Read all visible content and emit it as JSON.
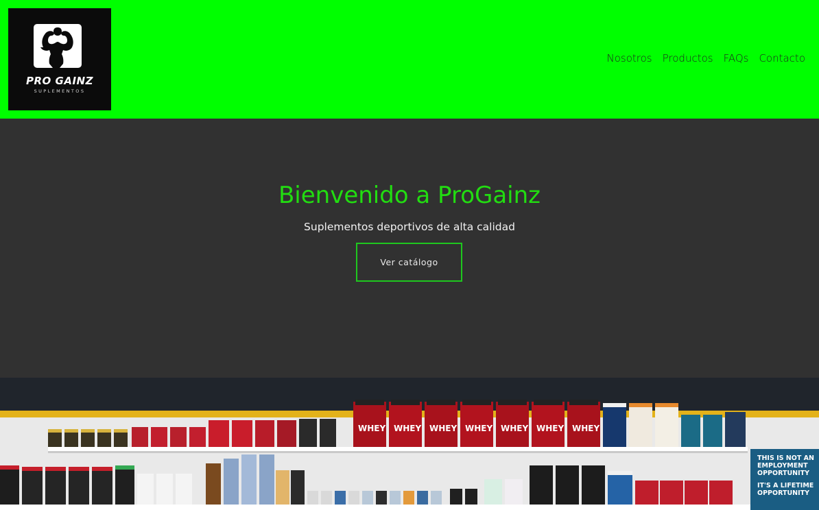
{
  "header": {
    "logo": {
      "brand": "PRO GAINZ",
      "tagline": "SUPLEMENTOS"
    },
    "nav": [
      "Nosotros",
      "Productos",
      "FAQs",
      "Contacto"
    ]
  },
  "hero": {
    "title": "Bienvenido a ProGainz",
    "subtitle": "Suplementos deportivos de alta calidad",
    "cta_label": "Ver catálogo"
  },
  "photo": {
    "poster_lines": [
      "THIS IS NOT AN",
      "EMPLOYMENT",
      "OPPORTUNITY",
      "IT'S A LIFETIME",
      "OPPORTUNITY"
    ],
    "jar_labels": [
      "WHEY",
      "WHEY",
      "WHEY",
      "WHEY",
      "WHEY",
      "WHEY",
      "WHEY"
    ]
  },
  "colors": {
    "header_bg": "#00ff00",
    "hero_bg": "#313131",
    "accent": "#22dd11"
  }
}
